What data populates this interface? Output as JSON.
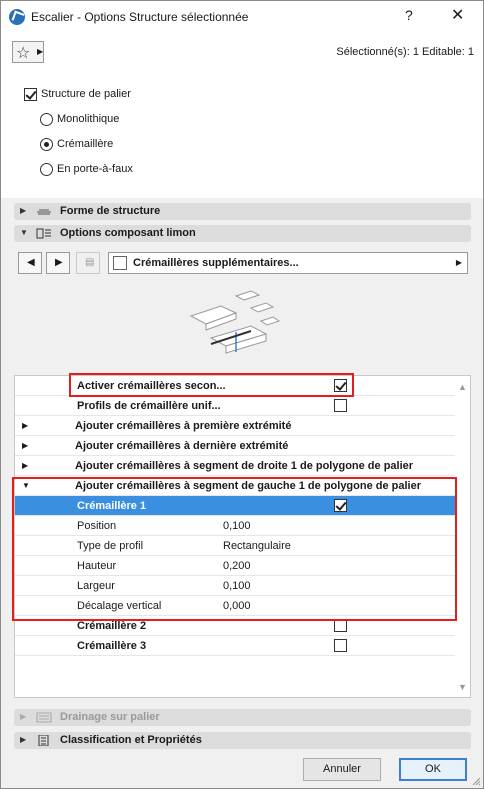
{
  "window": {
    "title": "Escalier - Options Structure sélectionnée",
    "help": "?",
    "close": "✕"
  },
  "toolbar": {
    "favorites_icon": "star-icon",
    "selection_info": "Sélectionné(s): 1 Editable: 1"
  },
  "landing": {
    "checkbox_label": "Structure de palier",
    "checked": true,
    "options": [
      {
        "label": "Monolithique",
        "selected": false
      },
      {
        "label": "Crémaillère",
        "selected": true
      },
      {
        "label": "En porte-à-faux",
        "selected": false
      }
    ]
  },
  "sections": {
    "structure_shape": "Forme de structure",
    "stringer_options": "Options composant limon",
    "drainage": "Drainage sur palier",
    "classification": "Classification et Propriétés"
  },
  "nav": {
    "dropdown_value": "Crémaillères supplémentaires..."
  },
  "list": {
    "rows": [
      {
        "label": "Activer crémaillères secon...",
        "checked": true
      },
      {
        "label": "Profils de crémaillère unif...",
        "checked": false
      },
      {
        "label": "Ajouter crémaillères à première extrémité"
      },
      {
        "label": "Ajouter crémaillères à dernière extrémité"
      },
      {
        "label": "Ajouter crémaillères à segment de droite 1 de polygone de palier"
      },
      {
        "label": "Ajouter crémaillères à segment de gauche 1 de polygone de palier"
      }
    ],
    "stringer1": {
      "label": "Crémaillère 1",
      "checked": true
    },
    "properties": [
      {
        "name": "Position",
        "value": "0,100"
      },
      {
        "name": "Type de profil",
        "value": "Rectangulaire"
      },
      {
        "name": "Hauteur",
        "value": "0,200"
      },
      {
        "name": "Largeur",
        "value": "0,100"
      },
      {
        "name": "Décalage vertical",
        "value": "0,000"
      }
    ],
    "stringer2": {
      "label": "Crémaillère 2",
      "checked": false
    },
    "stringer3": {
      "label": "Crémaillère 3",
      "checked": false
    }
  },
  "buttons": {
    "cancel": "Annuler",
    "ok": "OK"
  },
  "colors": {
    "selection": "#3b8fe0",
    "highlight_border": "#e0201e",
    "ok_border": "#3c7fd1"
  }
}
